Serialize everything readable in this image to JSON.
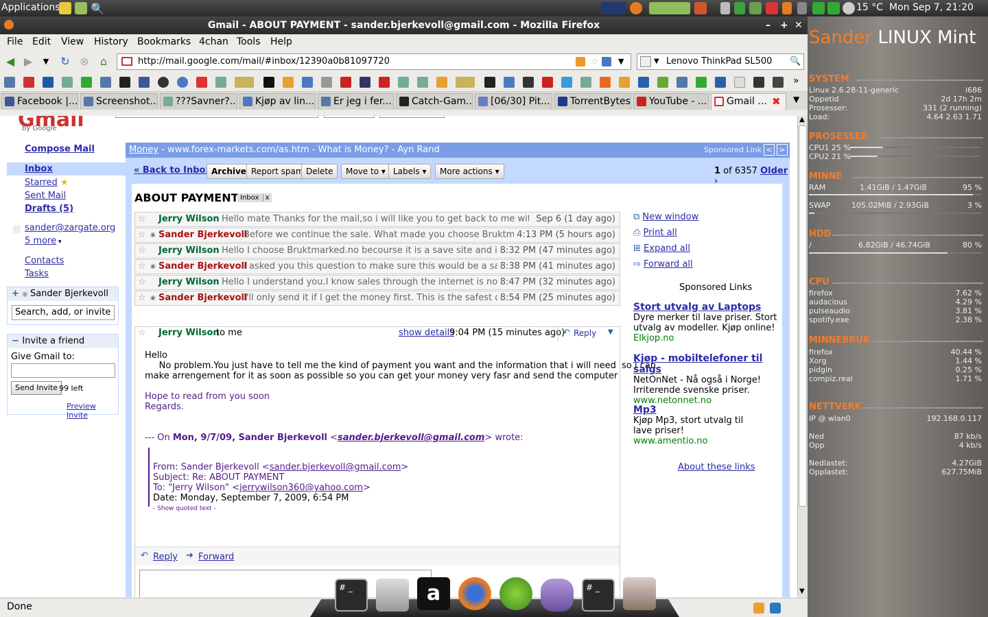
{
  "panel": {
    "applications": "Applications",
    "weather": "15 °C",
    "clock": "Mon Sep  7, 21:20"
  },
  "window": {
    "title": "Gmail - ABOUT PAYMENT - sander.bjerkevoll@gmail.com - Mozilla Firefox"
  },
  "menu": [
    "File",
    "Edit",
    "View",
    "History",
    "Bookmarks",
    "4chan",
    "Tools",
    "Help"
  ],
  "url": "http://mail.google.com/mail/#inbox/12390a0b81097720",
  "search": "Lenovo ThinkPad SL500",
  "tabs": [
    "Facebook |...",
    "Screenshot...",
    "???Savner?...",
    "Kjøp av lin...",
    "Er jeg i fer...",
    "Catch-Gam...",
    "[06/30] Pit...",
    "TorrentBytes",
    "YouTube - ...",
    "Gmail ..."
  ],
  "status": "Done",
  "gmail": {
    "logo_by": "by Google",
    "compose": "Compose Mail",
    "nav": [
      "Inbox",
      "Starred",
      "Sent Mail",
      "Drafts (5)"
    ],
    "account": "sander@zargate.org",
    "more": "5 more",
    "contacts": "Contacts",
    "tasks": "Tasks",
    "chat_user": "Sander Bjerkevoll",
    "chat_search": "Search, add, or invite",
    "invite_title": "Invite a friend",
    "give_gmail": "Give Gmail to:",
    "send_invite": "Send Invite",
    "invites_left": "99 left",
    "preview_invite": "Preview Invite"
  },
  "adbar": {
    "link": "Money",
    "text": " - www.forex-markets.com/as.htm - What is Money? - Ayn Rand",
    "sponsored": "Sponsored Link"
  },
  "toolbar": {
    "back": "« Back to Inbox",
    "archive": "Archive",
    "spam": "Report spam",
    "delete": "Delete",
    "move": "Move to ▾",
    "labels": "Labels ▾",
    "more": "More actions ▾",
    "count_num": "1",
    "count_rest": " of 6357 ",
    "older": "Older ›"
  },
  "subject": "ABOUT PAYMENT",
  "label_inbox": "Inbox",
  "label_x": "x",
  "messages": [
    {
      "from": "Jerry Wilson",
      "snippet": "Hello mate Thanks for the mail,so i will like you to get back to me with the ...",
      "date": "Sep 6 (1 day ago)"
    },
    {
      "from": "Sander Bjerkevoll",
      "snippet": "Before we continue the sale. What made you choose Bruktmarked.no, s",
      "date": "4:13 PM (5 hours ago)"
    },
    {
      "from": "Jerry Wilson",
      "snippet": "Hello I choose Bruktmarked.no becourse it is a save site and i have once I",
      "date": "8:32 PM (47 minutes ago)"
    },
    {
      "from": "Sander Bjerkevoll",
      "snippet": "I asked you this question to make sure this would be a safe sale betw",
      "date": "8:38 PM (41 minutes ago)"
    },
    {
      "from": "Jerry Wilson",
      "snippet": "Hello I understand you.I know sales through the internet is no longer save",
      "date": "8:47 PM (32 minutes ago)"
    },
    {
      "from": "Sander Bjerkevoll",
      "snippet": "I'll only send it if I get the money first. This is the safest deal for me,",
      "date": "8:54 PM (25 minutes ago)"
    }
  ],
  "open_msg": {
    "from": "Jerry Wilson",
    "to": "to me",
    "show_details": "show details",
    "date": "9:04 PM (15 minutes ago)",
    "reply": "Reply",
    "body1": "Hello",
    "body2": "     No problem.You just have to tell me the kind of payment you want and the information that i will need  so i can",
    "body3": "make arrengement for it as soon as possible so you can get your money very fasr and send the computer",
    "body4": "Hope to read from you soon",
    "body5": "Regards.",
    "quote_pre": "--- On ",
    "quote_bold": "Mon, 9/7/09, Sander Bjerkevoll",
    "quote_email": "sander.bjerkevoll@gmail.com",
    "quote_post": " wrote:",
    "q_from_pre": "From: Sander Bjerkevoll <",
    "q_from_email": "sander.bjerkevoll@gmail.com",
    "q_subject": "Subject: Re: ABOUT PAYMENT",
    "q_to_pre": "To: \"Jerry Wilson\" <",
    "q_to_email": "jerrywilson360@yahoo.com",
    "q_date": "Date: Monday, September 7, 2009, 6:54 PM",
    "show_quoted": "- Show quoted text -",
    "reply_link": "Reply",
    "forward_link": "Forward"
  },
  "actions": [
    "New window",
    "Print all",
    "Expand all",
    "Forward all"
  ],
  "ads_title": "Sponsored Links",
  "ads": [
    {
      "title": "Stort utvalg av Laptops",
      "desc": "Dyre merker til lave priser. Stort utvalg av modeller. Kjøp online!",
      "url": "Elkjop.no"
    },
    {
      "title": "Kjøp - mobiltelefoner til salgs",
      "desc": "NetOnNet - Nå også i Norge! Irriterende svenske priser.",
      "url": "www.netonnet.no"
    },
    {
      "title": "Mp3",
      "desc": "Kjøp Mp3, stort utvalg til lave priser!",
      "url": "www.amentio.no"
    }
  ],
  "about_links": "About these links",
  "conky": {
    "title1": "Sander",
    "title2": " LINUX Mint",
    "system": "SYSTEM",
    "kernel": "Linux 2.6.28-11-generic",
    "arch": "i686",
    "uptime_l": "Oppetid",
    "uptime": "2d 17h 2m",
    "procs_l": "Prosesser:",
    "procs": "331  (2  running)",
    "load_l": "Load:",
    "load": "4.64 2.63 1.71",
    "cpu_sec": "PROSESSER",
    "cpu1": "CPU1 25 %",
    "cpu2": "CPU2 21 %",
    "mem_sec": "MINNE",
    "ram_l": "RAM",
    "ram": "1.41GiB  / 1.47GiB",
    "ram_p": "95 %",
    "swap_l": "SWAP",
    "swap": "105.02MiB / 2.93GiB",
    "swap_p": "3  %",
    "hdd_sec": "HDD",
    "hdd_l": "/",
    "hdd": "6.82GiB  / 46.74GiB",
    "hdd_p": "80 %",
    "cpu_top": "CPU",
    "cputop": [
      [
        "firefox",
        "7.62 %"
      ],
      [
        "audacious",
        "4.29 %"
      ],
      [
        "pulseaudio",
        "3.81 %"
      ],
      [
        "spotify.exe",
        "2.38 %"
      ]
    ],
    "mem_top": "MINNEBRUK",
    "memtop": [
      [
        "firefox",
        "40.44 %"
      ],
      [
        "Xorg",
        "1.44 %"
      ],
      [
        "pidgin",
        "0.25 %"
      ],
      [
        "compiz.real",
        "1.71 %"
      ]
    ],
    "net_sec": "NETTVERK",
    "ip_l": "IP @ wlan0",
    "ip": "192.168.0.117",
    "down_l": "Ned",
    "down": "87   kb/s",
    "up_l": "Opp",
    "up": "4   kb/s",
    "dl_l": "Nedlastet:",
    "dl": "4.27GiB",
    "ul_l": "Opplastet:",
    "ul": "627.75MiB"
  },
  "colors": {
    "gmail_blue": "#c3d9ff",
    "ad_bar": "#7b9de8",
    "conky_accent": "#f07d2e",
    "link": "#2a2aa8"
  }
}
